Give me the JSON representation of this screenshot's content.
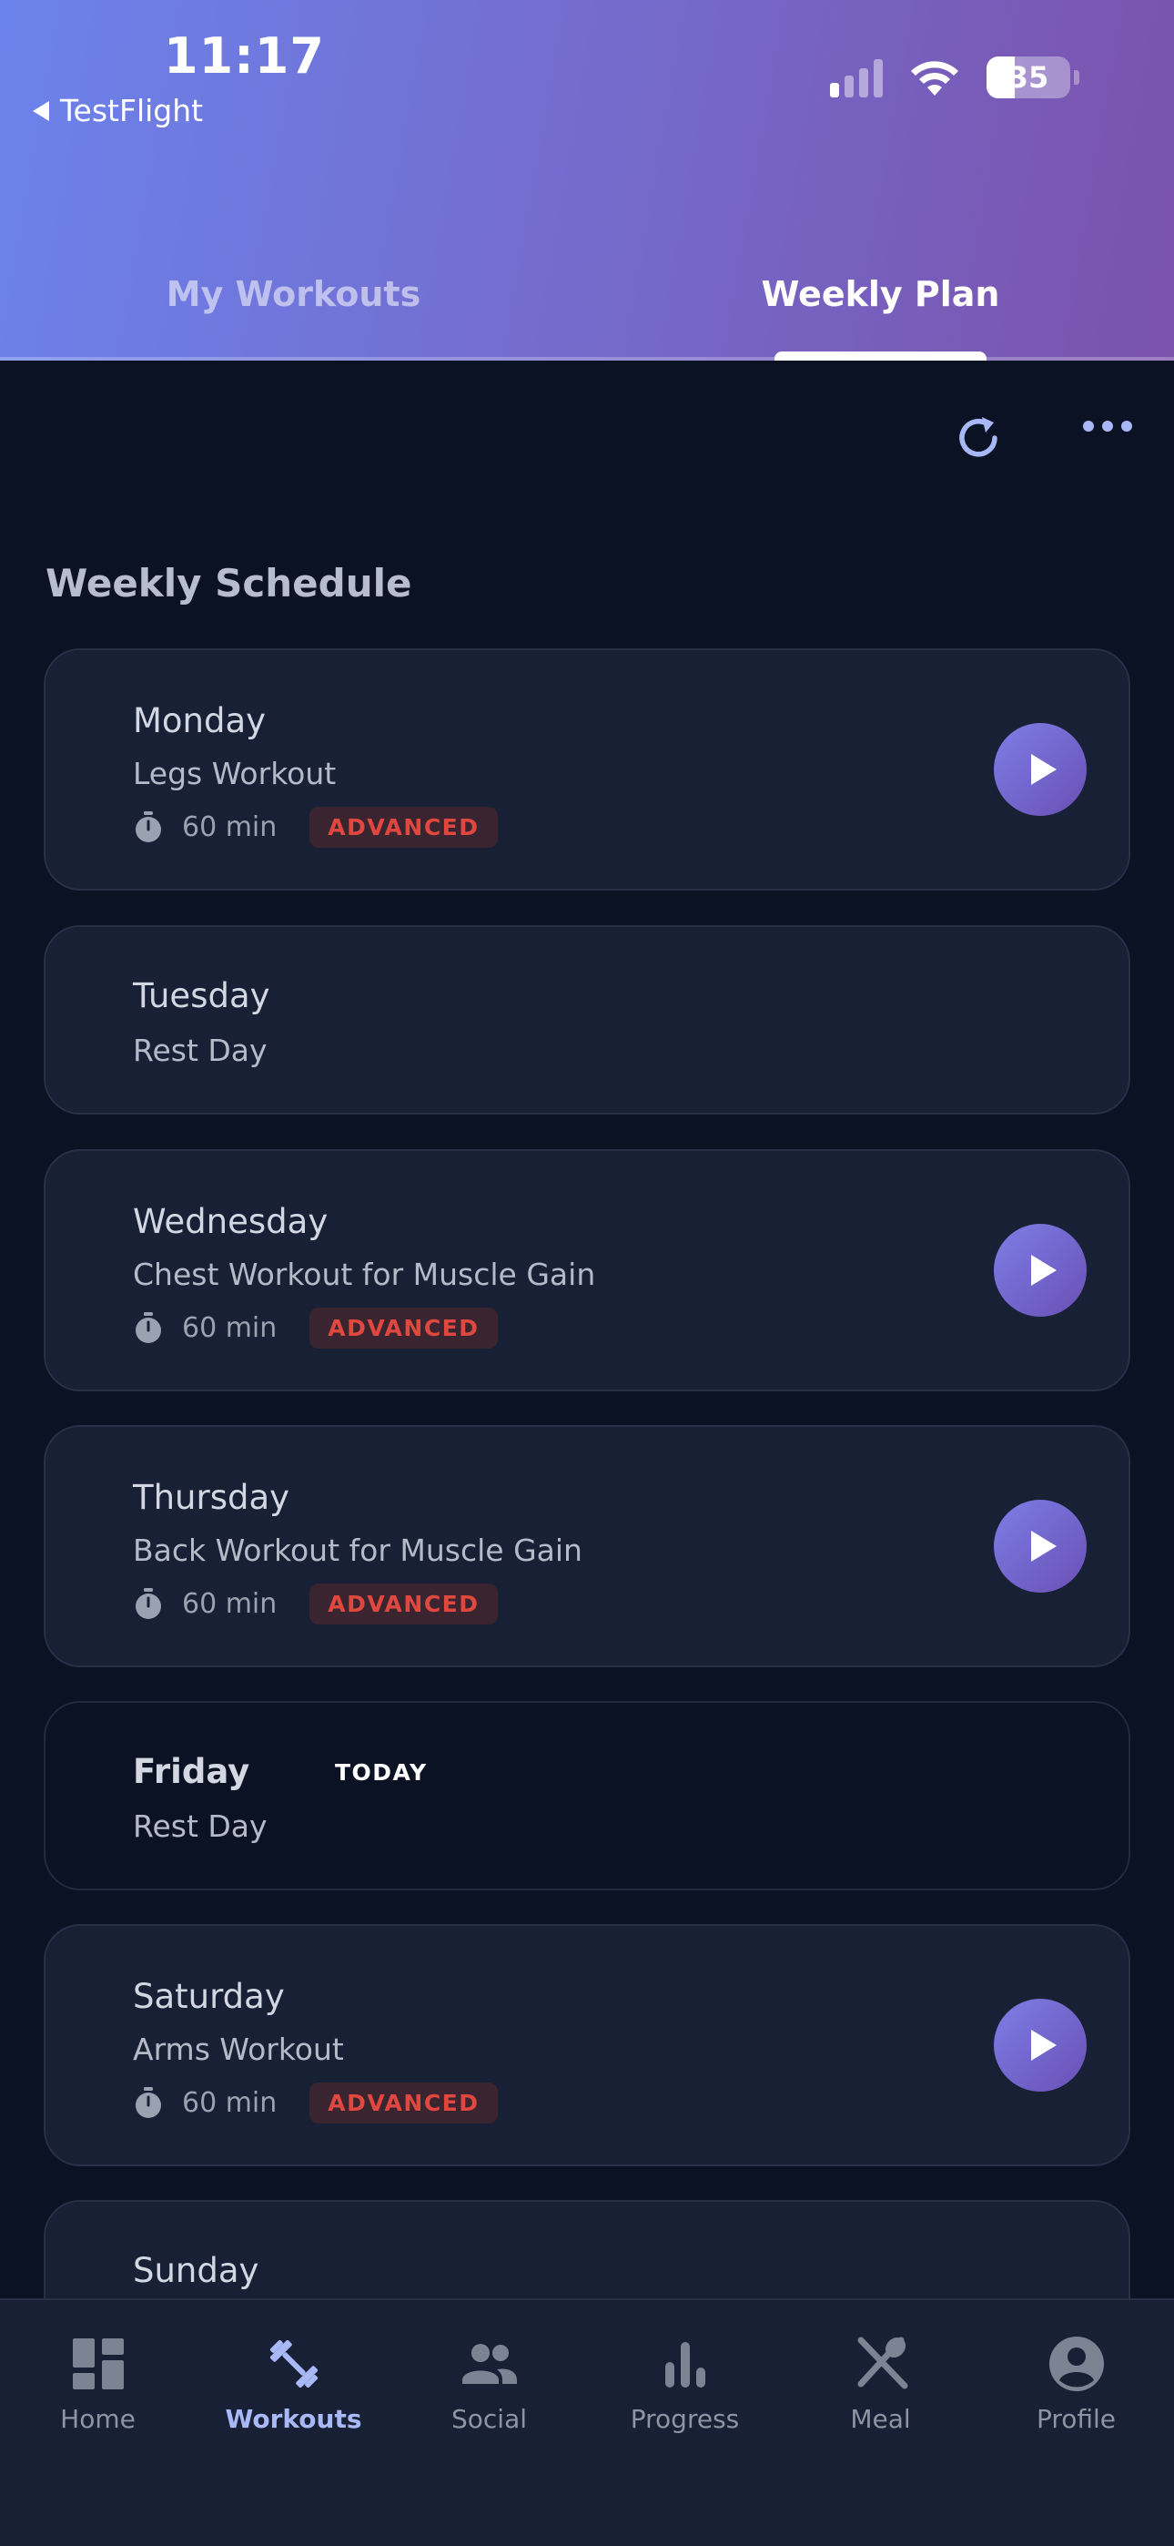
{
  "status_bar": {
    "time": "11:17",
    "back_app": "TestFlight",
    "battery": "35"
  },
  "tabs": [
    {
      "label": "My Workouts",
      "active": false
    },
    {
      "label": "Weekly Plan",
      "active": true
    }
  ],
  "icons": {
    "refresh": "refresh-icon",
    "more": "more-icon"
  },
  "section_title": "Weekly Schedule",
  "schedule": [
    {
      "day": "Monday",
      "workout": "Legs Workout",
      "duration": "60 min",
      "level": "ADVANCED"
    },
    {
      "day": "Tuesday",
      "workout": "Rest Day"
    },
    {
      "day": "Wednesday",
      "workout": "Chest Workout for Muscle Gain",
      "duration": "60 min",
      "level": "ADVANCED"
    },
    {
      "day": "Thursday",
      "workout": "Back Workout for Muscle Gain",
      "duration": "60 min",
      "level": "ADVANCED"
    },
    {
      "day": "Friday",
      "workout": "Rest Day",
      "today_label": "TODAY"
    },
    {
      "day": "Saturday",
      "workout": "Arms Workout",
      "duration": "60 min",
      "level": "ADVANCED"
    },
    {
      "day": "Sunday"
    }
  ],
  "nav": [
    {
      "label": "Home",
      "icon": "home-icon",
      "active": false
    },
    {
      "label": "Workouts",
      "icon": "dumbbell-icon",
      "active": true
    },
    {
      "label": "Social",
      "icon": "people-icon",
      "active": false
    },
    {
      "label": "Progress",
      "icon": "bar-chart-icon",
      "active": false
    },
    {
      "label": "Meal",
      "icon": "utensils-icon",
      "active": false
    },
    {
      "label": "Profile",
      "icon": "profile-icon",
      "active": false
    }
  ],
  "colors": {
    "accent": "#a9b8f7",
    "badge_text": "#e0483f",
    "background": "#0b1224",
    "card": "#182035"
  }
}
